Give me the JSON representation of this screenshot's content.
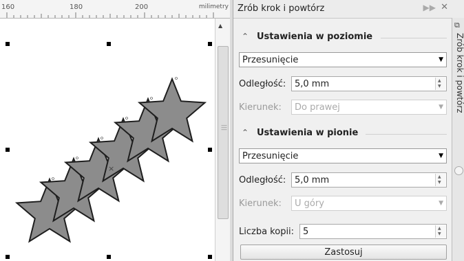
{
  "ruler": {
    "labels": [
      "160",
      "180",
      "200"
    ],
    "unit": "milimetry"
  },
  "panel": {
    "title": "Zrób krok i powtórz",
    "horizontal": {
      "heading": "Ustawienia w poziomie",
      "mode": "Przesunięcie",
      "distance_label": "Odległość:",
      "distance_value": "5,0 mm",
      "direction_label": "Kierunek:",
      "direction_value": "Do prawej"
    },
    "vertical": {
      "heading": "Ustawienia w pionie",
      "mode": "Przesunięcie",
      "distance_label": "Odległość:",
      "distance_value": "5,0 mm",
      "direction_label": "Kierunek:",
      "direction_value": "U góry"
    },
    "copies_label": "Liczba kopii:",
    "copies_value": "5",
    "apply_label": "Zastosuj"
  },
  "tabstrip": {
    "label": "Zrób krok i powtórz"
  },
  "colors": {
    "star_fill": "#8c8c8c",
    "star_stroke": "#1e1e1e",
    "panel_bg": "#f0f0f0"
  }
}
